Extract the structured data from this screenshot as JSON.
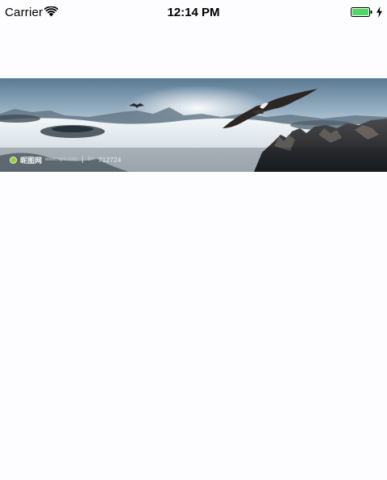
{
  "status_bar": {
    "carrier": "Carrier",
    "time": "12:14 PM",
    "wifi_icon": "wifi-icon",
    "battery_icon": "battery-icon",
    "charging_icon": "charging-bolt-icon",
    "battery_color": "#4cd964"
  },
  "banner": {
    "image": "eagle-over-sea-of-clouds",
    "watermark": {
      "brand": "昵图网",
      "site": "www.nipic.com",
      "id_label": "BY:",
      "id_value": "712724"
    }
  },
  "colors": {
    "background": "#fdfcfe",
    "sky_top": "#5f7f98",
    "sky_mid": "#c9d8e2",
    "clouds": "#eef3f6",
    "mountains": "#2c3238"
  }
}
